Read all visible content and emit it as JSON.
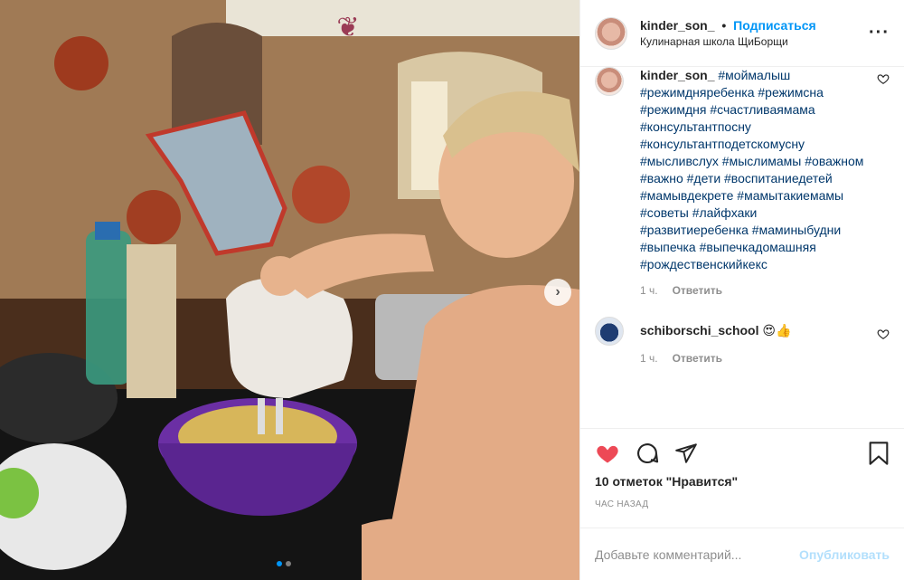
{
  "post": {
    "username": "kinder_son_",
    "separator": "•",
    "follow_label": "Подписаться",
    "location": "Кулинарная школа ЩиБорщи",
    "more_icon": "more-horizontal-icon"
  },
  "caption": {
    "username": "kinder_son_",
    "text": "#моймалыш #режимдняребенка #режимсна #режимдня #счастливаямама #консультантпосну #консультантподетскомусну #мысливслух #мыслимамы #оважном #важно #дети #воспитаниедетей #мамывдекрете #мамытакиемамы #советы #лайфхаки #развитиеребенка #маминыбудни #выпечка #выпечкадомашняя #рождественскийкекс",
    "time": "1 ч.",
    "reply_label": "Ответить"
  },
  "comment": {
    "username": "schiborschi_school",
    "text": "😍👍",
    "time": "1 ч.",
    "reply_label": "Ответить"
  },
  "actions": {
    "likes_text": "10 отметок \"Нравится\"",
    "time_ago": "час назад",
    "like_color": "#ed4956"
  },
  "add_comment": {
    "placeholder": "Добавьте комментарий...",
    "post_label": "Опубликовать"
  },
  "carousel": {
    "current": 1,
    "total": 2
  }
}
